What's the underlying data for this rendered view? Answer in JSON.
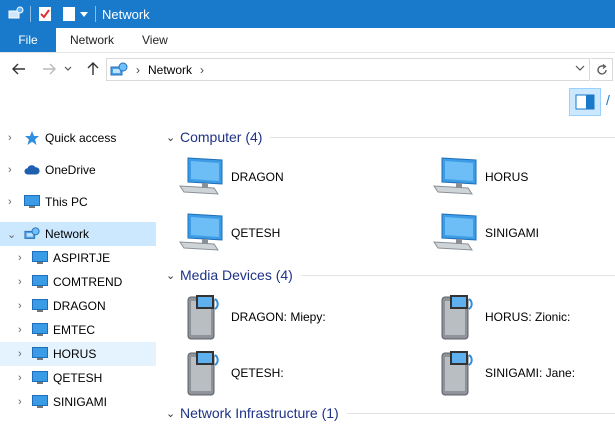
{
  "window": {
    "title": "Network"
  },
  "ribbon": {
    "file": "File",
    "tabs": [
      "Network",
      "View"
    ]
  },
  "address": {
    "crumb": "Network"
  },
  "nav": {
    "items": [
      {
        "label": "Quick access",
        "icon": "star-icon"
      },
      {
        "label": "OneDrive",
        "icon": "cloud-icon"
      },
      {
        "label": "This PC",
        "icon": "computer-icon"
      },
      {
        "label": "Network",
        "icon": "network-icon"
      },
      {
        "label": "ASPIRTJE",
        "icon": "computer-icon"
      },
      {
        "label": "COMTREND",
        "icon": "computer-icon"
      },
      {
        "label": "DRAGON",
        "icon": "computer-icon"
      },
      {
        "label": "EMTEC",
        "icon": "computer-icon"
      },
      {
        "label": "HORUS",
        "icon": "computer-icon"
      },
      {
        "label": "QETESH",
        "icon": "computer-icon"
      },
      {
        "label": "SINIGAMI",
        "icon": "computer-icon"
      }
    ]
  },
  "groups": [
    {
      "title": "Computer (4)",
      "items": [
        "DRAGON",
        "HORUS",
        "QETESH",
        "SINIGAMI"
      ]
    },
    {
      "title": "Media Devices (4)",
      "items": [
        "DRAGON: Miepy:",
        "HORUS: Zionic:",
        "QETESH:",
        "SINIGAMI: Jane:"
      ]
    },
    {
      "title": "Network Infrastructure (1)",
      "items": []
    }
  ],
  "colors": {
    "accent": "#1979ca",
    "selection": "#cce8ff",
    "group_title": "#1e3287"
  }
}
